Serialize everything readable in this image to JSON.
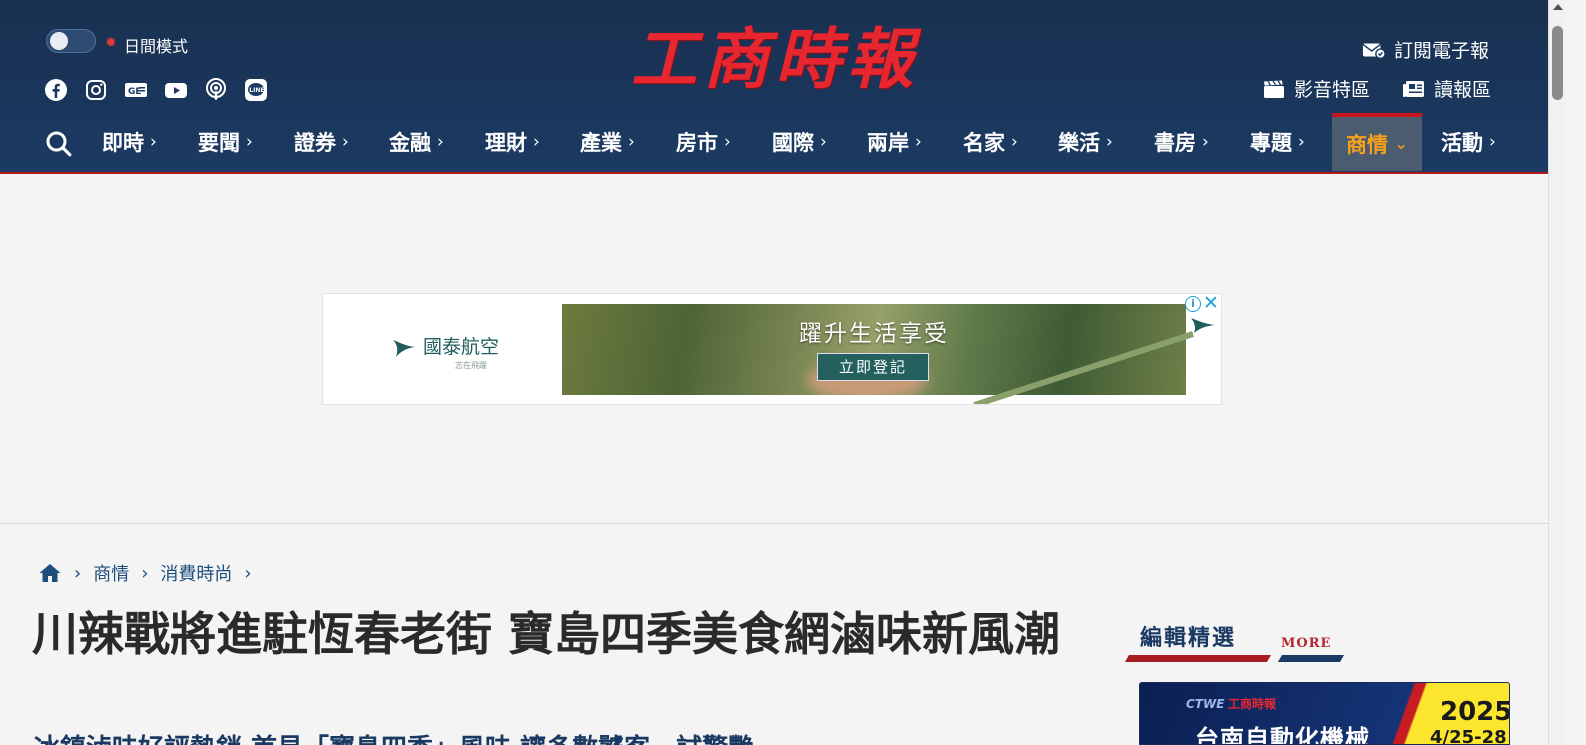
{
  "header": {
    "mode_label": "日間模式",
    "logo_text": "工商時報",
    "subscribe_label": "訂閱電子報",
    "video_label": "影音特區",
    "reader_label": "讀報區",
    "social_icons": [
      "facebook-icon",
      "instagram-icon",
      "google-news-icon",
      "youtube-icon",
      "podcast-icon",
      "line-icon"
    ]
  },
  "nav": {
    "items": [
      {
        "label": "即時"
      },
      {
        "label": "要聞"
      },
      {
        "label": "證券"
      },
      {
        "label": "金融"
      },
      {
        "label": "理財"
      },
      {
        "label": "產業"
      },
      {
        "label": "房市"
      },
      {
        "label": "國際"
      },
      {
        "label": "兩岸"
      },
      {
        "label": "名家"
      },
      {
        "label": "樂活"
      },
      {
        "label": "書房"
      },
      {
        "label": "專題"
      },
      {
        "label": "商情"
      },
      {
        "label": "活動"
      }
    ],
    "active_index": 13,
    "chevron": "›",
    "active_chevron": "⌄"
  },
  "ad": {
    "brand": "國泰航空",
    "brand_sub": "志在飛躍",
    "headline": "躍升生活享受",
    "cta": "立即登記",
    "info": "i",
    "close": "✕"
  },
  "breadcrumb": {
    "items": [
      "商情",
      "消費時尚"
    ],
    "sep": "›"
  },
  "article": {
    "title": "川辣戰將進駐恆春老街 寶島四季美食網滷味新風潮",
    "subtitle": "冰鎮滷味好評熱銷 首見「寶島四季」風味 讓多數饕客一試驚艷"
  },
  "sidebar": {
    "heading": "編輯精選",
    "more": "MORE",
    "banner": {
      "brand": "CTWE",
      "paper": "工商時報",
      "text": "台南自動化機械",
      "year": "2025",
      "date": "4/25-28"
    }
  },
  "colors": {
    "header_bg": "#1b3a63",
    "logo_red": "#e8262f",
    "active_nav": "#f7a21b",
    "accent_red": "#b31b1b"
  }
}
